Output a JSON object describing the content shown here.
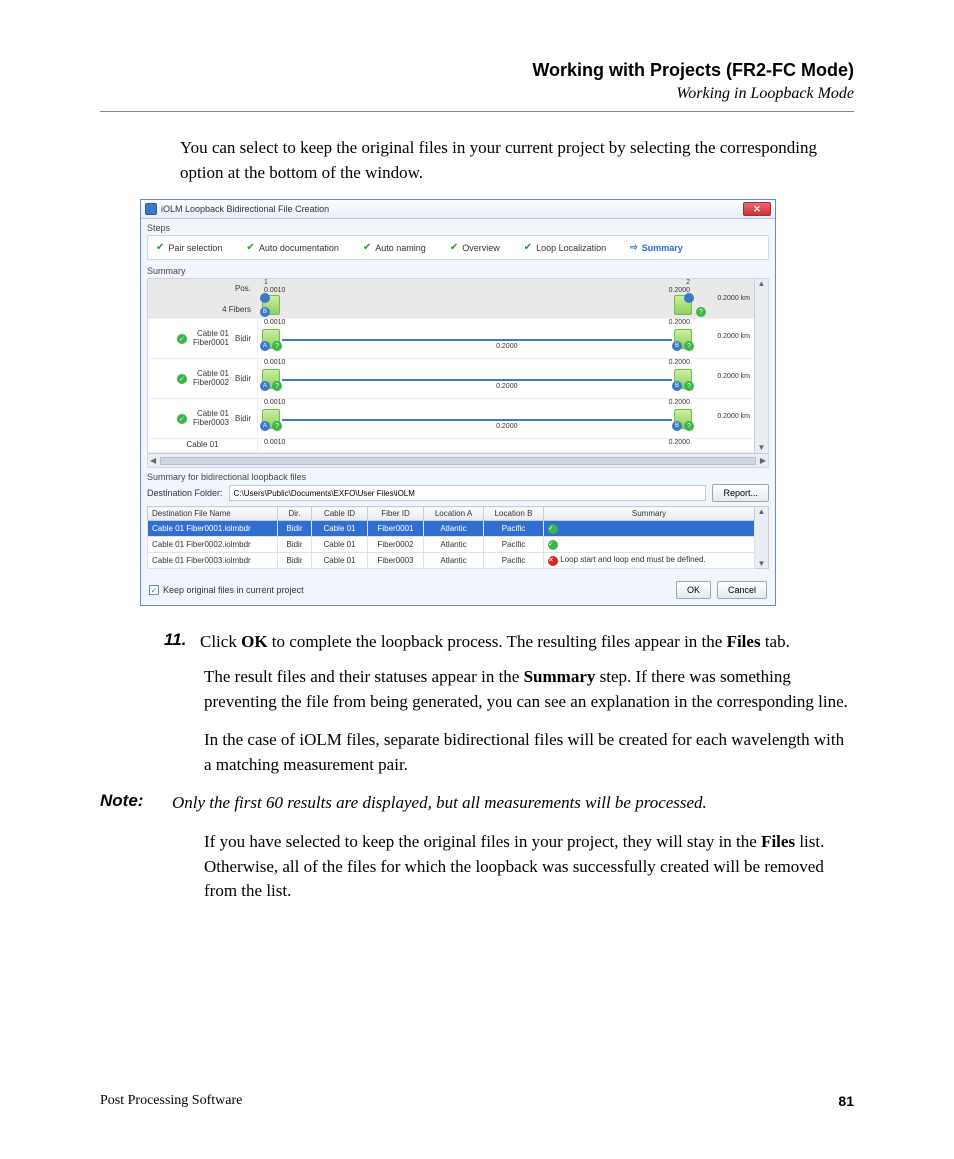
{
  "header": {
    "chapter": "Working with Projects (FR2-FC Mode)",
    "section": "Working in Loopback Mode"
  },
  "intro": "You can select to keep the original files in your current project by selecting the corresponding option at the bottom of the window.",
  "win": {
    "title": "iOLM Loopback Bidirectional File Creation",
    "steps_label": "Steps",
    "steps": {
      "pair": "Pair selection",
      "autodoc": "Auto documentation",
      "autoname": "Auto naming",
      "overview": "Overview",
      "loop": "Loop Localization",
      "summary": "Summary"
    },
    "summary_label": "Summary",
    "pos_label": "Pos.",
    "fibers_label": "4 Fibers",
    "col1": "1",
    "col2": "2",
    "left_val": "0.0010",
    "right_val": "0.2000",
    "dist": "0.2000 km",
    "mid": "0.2000",
    "rows": [
      {
        "name": "Cable 01\nFiber0001",
        "dir": "Bidir"
      },
      {
        "name": "Cable 01\nFiber0002",
        "dir": "Bidir"
      },
      {
        "name": "Cable 01\nFiber0003",
        "dir": "Bidir"
      }
    ],
    "partial_row": "Cable 01",
    "sub_label": "Summary for bidirectional loopback files",
    "dest_label": "Destination Folder:",
    "dest_path": "C:\\Users\\Public\\Documents\\EXFO\\User Files\\iOLM",
    "report_btn": "Report...",
    "table": {
      "headers": {
        "file": "Destination File Name",
        "dir": "Dir.",
        "cable": "Cable ID",
        "fiber": "Fiber ID",
        "loca": "Location A",
        "locb": "Location B",
        "summary": "Summary"
      },
      "rows": [
        {
          "file": "Cable 01 Fiber0001.iolmbdr",
          "dir": "Bidir",
          "cable": "Cable 01",
          "fiber": "Fiber0001",
          "la": "Atlantic",
          "lb": "Pacific",
          "status": "ok",
          "msg": ""
        },
        {
          "file": "Cable 01 Fiber0002.iolmbdr",
          "dir": "Bidir",
          "cable": "Cable 01",
          "fiber": "Fiber0002",
          "la": "Atlantic",
          "lb": "Pacific",
          "status": "ok",
          "msg": ""
        },
        {
          "file": "Cable 01 Fiber0003.iolmbdr",
          "dir": "Bidir",
          "cable": "Cable 01",
          "fiber": "Fiber0003",
          "la": "Atlantic",
          "lb": "Pacific",
          "status": "err",
          "msg": "Loop start and loop end must be defined."
        }
      ]
    },
    "keep_label": "Keep original files in current project",
    "ok": "OK",
    "cancel": "Cancel"
  },
  "step11": {
    "num": "11.",
    "p1a": "Click ",
    "p1b": "OK",
    "p1c": " to complete the loopback process. The resulting files appear in the ",
    "p1d": "Files",
    "p1e": " tab.",
    "p2a": "The result files and their statuses appear in the ",
    "p2b": "Summary",
    "p2c": " step. If there was something preventing the file from being generated, you can see an explanation in the corresponding line.",
    "p3": "In the case of iOLM files, separate bidirectional files will be created for each wavelength with a matching measurement pair."
  },
  "note": {
    "label": "Note:",
    "body": "Only the first 60 results are displayed, but all measurements will be processed."
  },
  "after_note_a": "If you have selected to keep the original files in your project, they will stay in the ",
  "after_note_b": "Files",
  "after_note_c": " list. Otherwise, all of the files for which the loopback was successfully created will be removed from the list.",
  "footer": {
    "product": "Post Processing Software",
    "page": "81"
  }
}
